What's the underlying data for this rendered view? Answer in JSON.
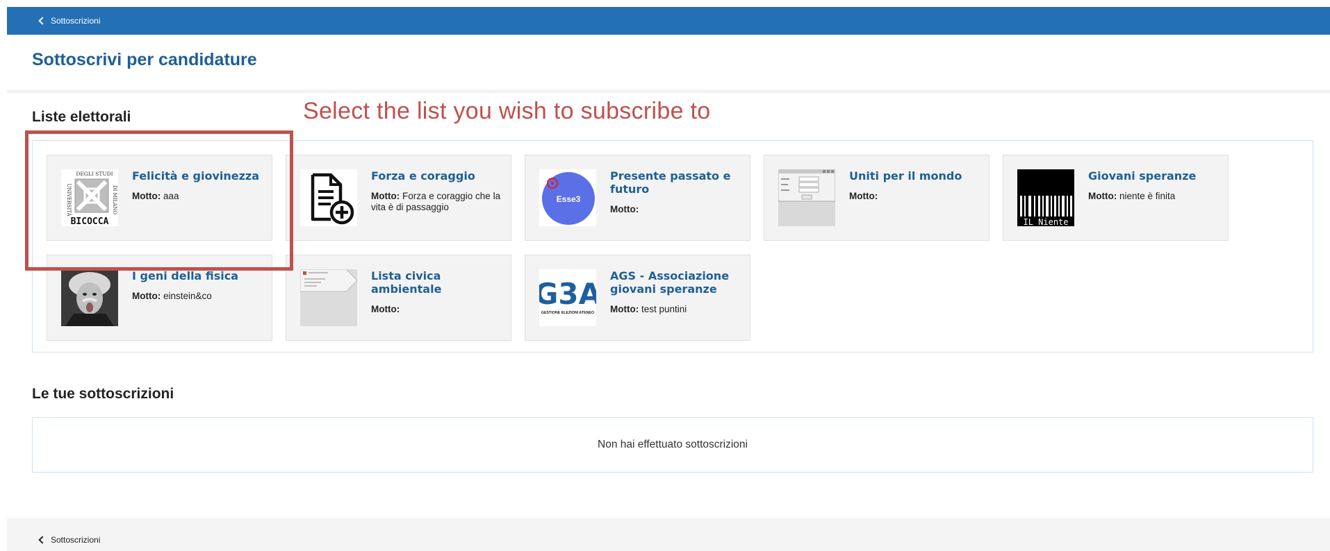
{
  "header": {
    "back_label": "Sottoscrizioni"
  },
  "page_title": "Sottoscrivi per candidature",
  "annotation": {
    "text": "Select the list you wish to subscribe to",
    "color": "#c0504d"
  },
  "lists_section": {
    "title": "Liste elettorali",
    "motto_label": "Motto:",
    "cards": [
      {
        "name": "Felicità e giovinezza",
        "motto": "aaa",
        "logo": "bicocca-university-logo"
      },
      {
        "name": "Forza e coraggio",
        "motto": "Forza e coraggio che la vita è di passaggio",
        "logo": "document-add-icon"
      },
      {
        "name": "Presente passato e futuro",
        "motto": "",
        "logo": "esse3-logo"
      },
      {
        "name": "Uniti per il mondo",
        "motto": "",
        "logo": "form-screenshot-thumbnail"
      },
      {
        "name": "Giovani speranze",
        "motto": "niente è finita",
        "logo": "il-niente-barcode-logo"
      },
      {
        "name": "I geni della fisica",
        "motto": "einstein&co",
        "logo": "einstein-photo"
      },
      {
        "name": "Lista civica ambientale",
        "motto": "",
        "logo": "document-thumbnail"
      },
      {
        "name": "AGS - Associazione giovani speranze",
        "motto": "test puntini",
        "logo": "g3a-logo"
      }
    ]
  },
  "logo_text": {
    "bicocca_top": "DEGLI STUDI",
    "bicocca_left": "UNIVERSITÀ",
    "bicocca_right": "DI MILANO",
    "bicocca_name": "BICOCCA",
    "esse3": "Esse3",
    "il_niente": "IL Niente",
    "g3a": "G3A",
    "g3a_caption": "GESTIONE ELEZIONI ATENEO"
  },
  "subscriptions_section": {
    "title": "Le tue sottoscrizioni",
    "empty_message": "Non hai effettuato sottoscrizioni"
  },
  "footer": {
    "back_label": "Sottoscrizioni"
  },
  "colors": {
    "header_bg": "#2470b5",
    "title": "#1f5f96",
    "card_bg": "#f3f3f3",
    "panel_border": "#cfe3f1"
  }
}
